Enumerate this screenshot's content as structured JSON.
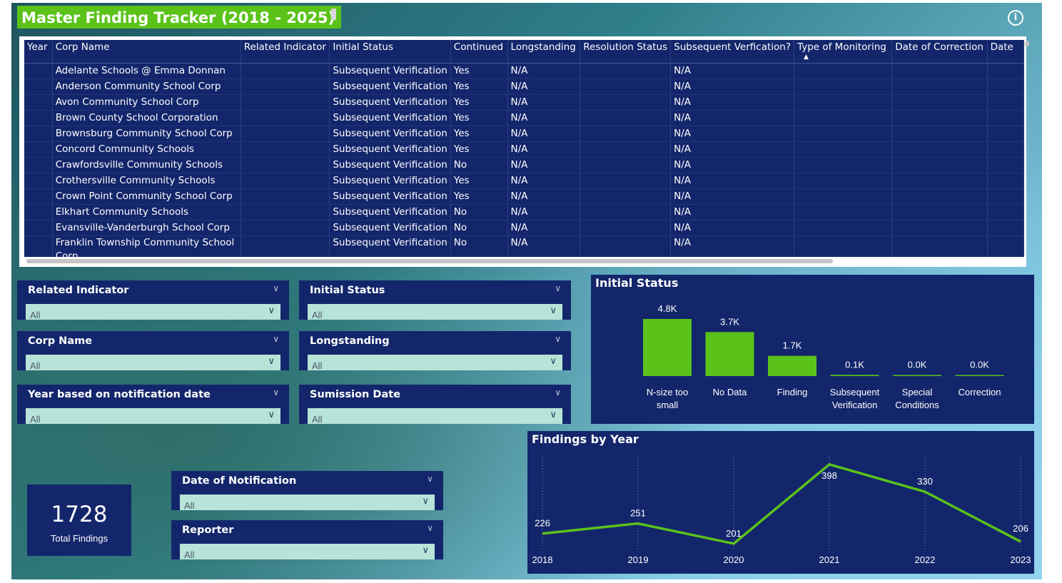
{
  "title": "Master Finding Tracker (2018 - 2025)",
  "table": {
    "columns": [
      "Year",
      "Corp Name",
      "Related Indicator",
      "Initial Status",
      "Continued",
      "Longstanding",
      "Resolution Status",
      "Subsequent Verfication?",
      "Type of Monitoring",
      "Date of Correction",
      "Date"
    ],
    "rows": [
      [
        "",
        "Adelante Schools @ Emma Donnan",
        "",
        "Subsequent Verification",
        "Yes",
        "N/A",
        "",
        "N/A",
        "",
        "",
        ""
      ],
      [
        "",
        "Anderson Community School Corp",
        "",
        "Subsequent Verification",
        "Yes",
        "N/A",
        "",
        "N/A",
        "",
        "",
        ""
      ],
      [
        "",
        "Avon Community School Corp",
        "",
        "Subsequent Verification",
        "Yes",
        "N/A",
        "",
        "N/A",
        "",
        "",
        ""
      ],
      [
        "",
        "Brown County School Corporation",
        "",
        "Subsequent Verification",
        "Yes",
        "N/A",
        "",
        "N/A",
        "",
        "",
        ""
      ],
      [
        "",
        "Brownsburg Community School Corp",
        "",
        "Subsequent Verification",
        "Yes",
        "N/A",
        "",
        "N/A",
        "",
        "",
        ""
      ],
      [
        "",
        "Concord Community Schools",
        "",
        "Subsequent Verification",
        "Yes",
        "N/A",
        "",
        "N/A",
        "",
        "",
        ""
      ],
      [
        "",
        "Crawfordsville Community Schools",
        "",
        "Subsequent Verification",
        "No",
        "N/A",
        "",
        "N/A",
        "",
        "",
        ""
      ],
      [
        "",
        "Crothersville Community Schools",
        "",
        "Subsequent Verification",
        "Yes",
        "N/A",
        "",
        "N/A",
        "",
        "",
        ""
      ],
      [
        "",
        "Crown Point Community School Corp",
        "",
        "Subsequent Verification",
        "Yes",
        "N/A",
        "",
        "N/A",
        "",
        "",
        ""
      ],
      [
        "",
        "Elkhart Community Schools",
        "",
        "Subsequent Verification",
        "No",
        "N/A",
        "",
        "N/A",
        "",
        "",
        ""
      ],
      [
        "",
        "Evansville-Vanderburgh School Corp",
        "",
        "Subsequent Verification",
        "No",
        "N/A",
        "",
        "N/A",
        "",
        "",
        ""
      ],
      [
        "",
        "Franklin Township Community School Corp",
        "",
        "Subsequent Verification",
        "No",
        "N/A",
        "",
        "N/A",
        "",
        "",
        ""
      ]
    ]
  },
  "slicers": {
    "related_indicator": {
      "label": "Related Indicator",
      "value": "All"
    },
    "initial_status": {
      "label": "Initial Status",
      "value": "All"
    },
    "corp_name": {
      "label": "Corp Name",
      "value": "All"
    },
    "longstanding": {
      "label": "Longstanding",
      "value": "All"
    },
    "year_notification": {
      "label": "Year based on notification date",
      "value": "All"
    },
    "submission_date": {
      "label": "Sumission Date",
      "value": "All"
    },
    "date_notification": {
      "label": "Date of Notification",
      "value": "All"
    },
    "reporter": {
      "label": "Reporter",
      "value": "All"
    }
  },
  "kpi": {
    "value": "1728",
    "label": "Total Findings"
  },
  "colors": {
    "accent": "#5bc21a",
    "panel": "#13266b",
    "slicer_box": "#b8e3d8"
  },
  "icons": {
    "info": "info-icon",
    "chevron": "chevron-down-icon"
  },
  "chart_data": [
    {
      "type": "bar",
      "title": "Initial Status",
      "categories": [
        "N-size too small",
        "No Data",
        "Finding",
        "Subsequent Verification",
        "Special Conditions",
        "Correction"
      ],
      "values": [
        4800,
        3700,
        1700,
        100,
        0,
        0
      ],
      "data_labels": [
        "4.8K",
        "3.7K",
        "1.7K",
        "0.1K",
        "0.0K",
        "0.0K"
      ],
      "ylim": [
        0,
        4800
      ],
      "grid": false
    },
    {
      "type": "line",
      "title": "Findings by Year",
      "x": [
        "2018",
        "2019",
        "2020",
        "2021",
        "2022",
        "2023"
      ],
      "values": [
        226,
        251,
        201,
        398,
        330,
        206
      ],
      "ylim": [
        190,
        410
      ],
      "grid": false
    }
  ]
}
